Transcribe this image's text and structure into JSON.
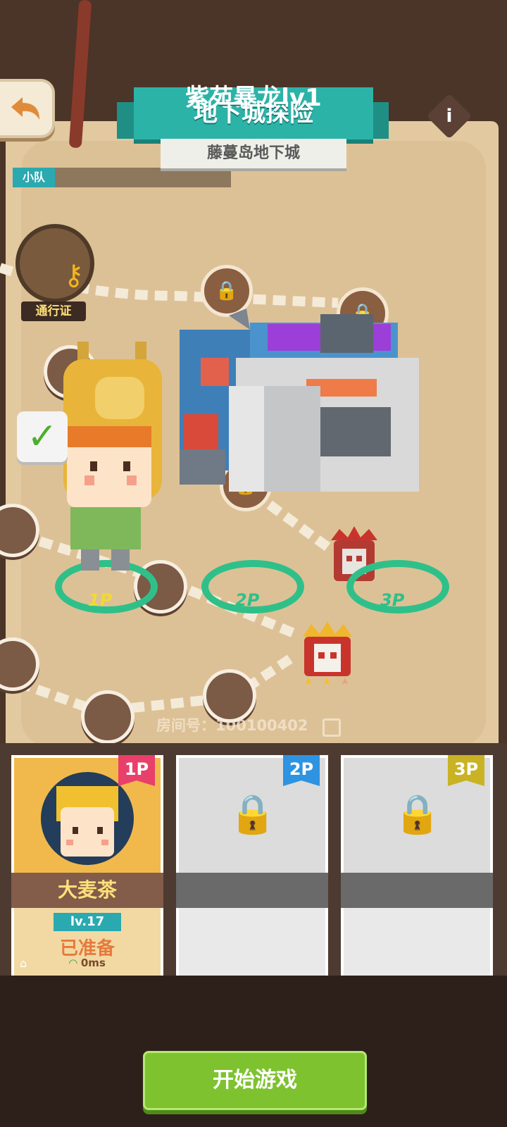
{
  "header": {
    "title_overlay": "紫苑暴龙lv1",
    "title": "地下城探险",
    "subtitle": "藤蔓岛地下城",
    "info_glyph": "i",
    "back_icon": "back-arrow-icon"
  },
  "team": {
    "tag_label": "小队"
  },
  "pass": {
    "label": "通行证",
    "key_icon": "key-icon"
  },
  "slots": [
    {
      "label": "1P",
      "color": "#f3d832"
    },
    {
      "label": "2P",
      "color": "#2fc08a"
    },
    {
      "label": "3P",
      "color": "#2fc08a"
    }
  ],
  "room": {
    "text": "房间号：100100402"
  },
  "players": [
    {
      "tag": "1P",
      "tag_color": "#e8406a",
      "name": "大麦茶",
      "level": "lv.17",
      "status": "已准备",
      "ping": "0ms"
    },
    {
      "tag": "2P",
      "tag_color": "#2e93e0",
      "locked": true
    },
    {
      "tag": "3P",
      "tag_color": "#c9b324",
      "locked": true
    }
  ],
  "footer": {
    "start_label": "开始游戏"
  }
}
